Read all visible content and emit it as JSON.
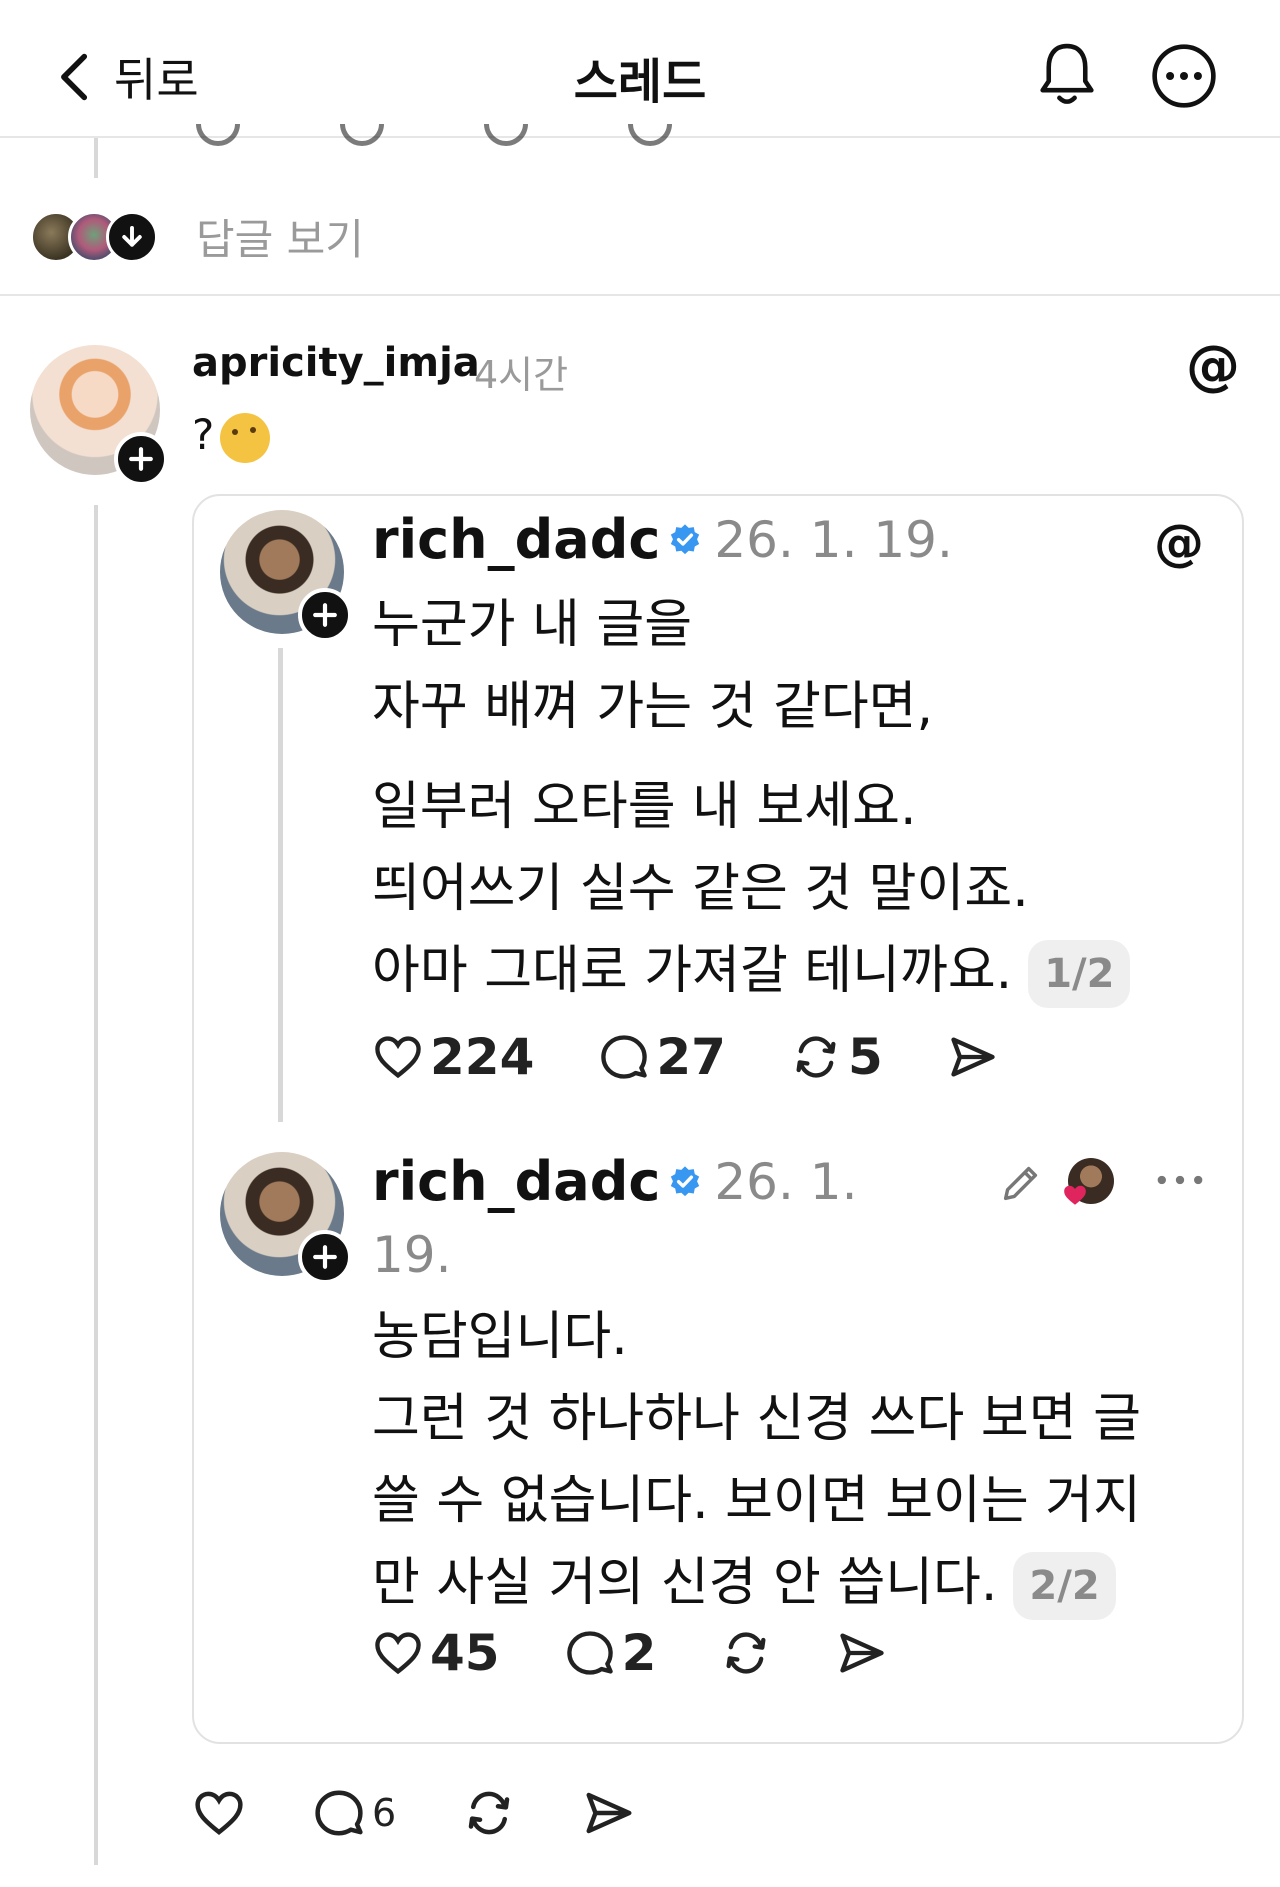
{
  "header": {
    "back_label": "뒤로",
    "title": "스레드",
    "icons": [
      "chevron-left-icon",
      "bell-icon",
      "more-icon"
    ]
  },
  "replies": {
    "label": "답글 보기"
  },
  "main_post": {
    "username": "apricity_imja",
    "time": "4시간",
    "text": "?",
    "emoji": "thinking-face",
    "actions": {
      "replies": "6"
    }
  },
  "quoted_thread": {
    "posts": [
      {
        "username": "rich_dadc",
        "date": "26. 1. 19.",
        "lines": [
          "누군가 내 글을",
          "자꾸 배껴 가는 것 같다면,",
          "일부러 오타를 내 보세요.",
          "띄어쓰기 실수 같은 것 말이죠.",
          "아마 그대로 가져갈 테니까요."
        ],
        "page": "1/2",
        "likes": "224",
        "replies": "27",
        "reposts": "5"
      },
      {
        "username": "rich_dadc",
        "date": "26. 1.",
        "date_cont": "19.",
        "lines": [
          "농담입니다.",
          "그런 것 하나하나 신경 쓰다 보면 글",
          "쓸 수 없습니다. 보이면 보이는 거지",
          "만 사실 거의 신경 안 씁니다."
        ],
        "page": "2/2",
        "likes": "45",
        "replies": "2"
      }
    ]
  },
  "colors": {
    "verified": "#3897f0",
    "muted": "#9a9a9a",
    "divider": "#e6e6e6",
    "heart": "#e0245e"
  }
}
